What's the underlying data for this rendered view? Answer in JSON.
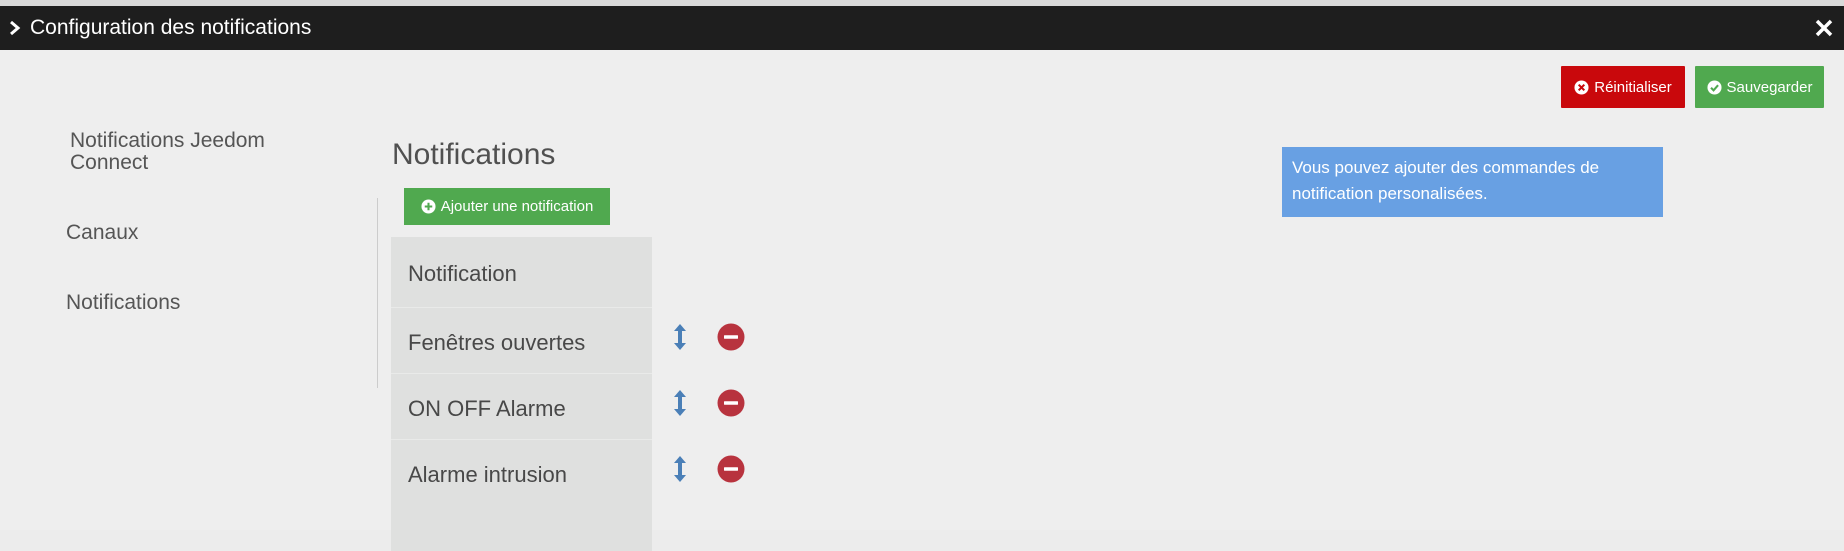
{
  "window": {
    "title": "Configuration des notifications",
    "chevron_icon": "chevron-right-icon",
    "close_icon": "close-icon"
  },
  "toolbar": {
    "reset_label": "Réinitialiser",
    "save_label": "Sauvegarder",
    "reset_color": "#c9080c",
    "save_color": "#50a94f"
  },
  "sidebar": {
    "items": [
      {
        "label": "Notifications Jeedom Connect"
      },
      {
        "label": "Canaux"
      },
      {
        "label": "Notifications"
      }
    ]
  },
  "main": {
    "title": "Notifications",
    "add_label": "Ajouter une notification",
    "table": {
      "header": "Notification",
      "rows": [
        {
          "name": "Fenêtres ouvertes"
        },
        {
          "name": "ON OFF Alarme"
        },
        {
          "name": "Alarme intrusion"
        }
      ]
    },
    "info": "Vous pouvez ajouter des commandes de notification personalisées."
  }
}
